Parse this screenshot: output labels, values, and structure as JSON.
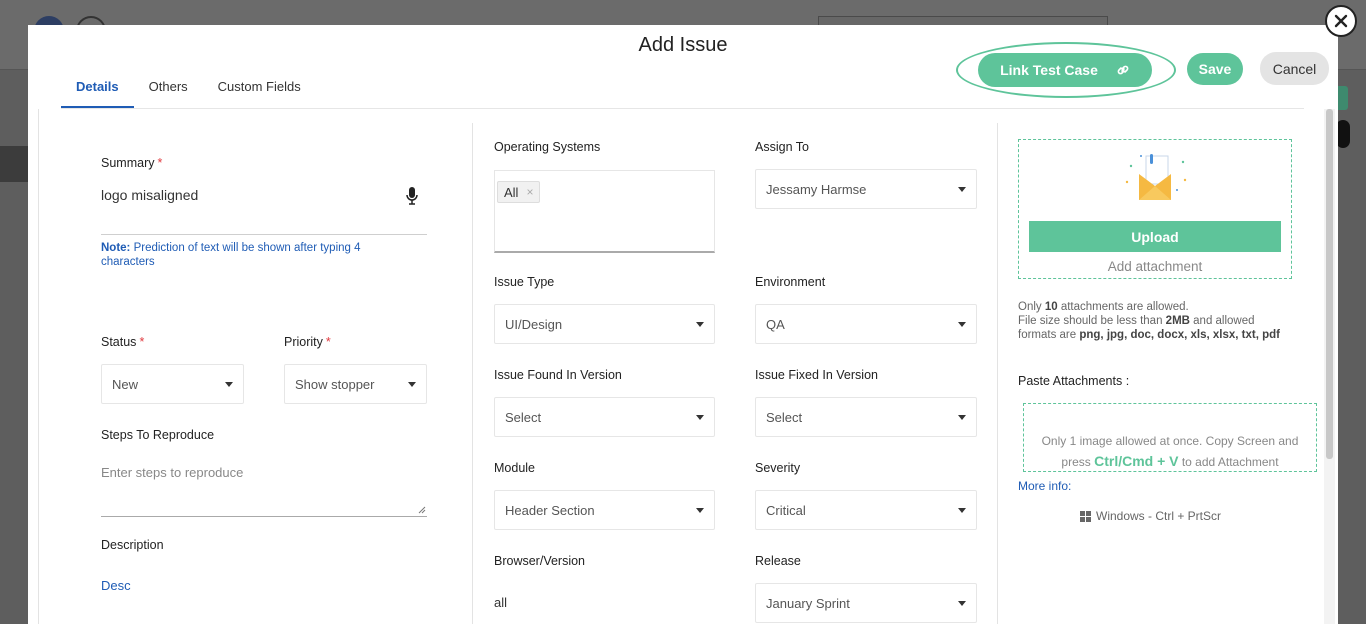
{
  "modal": {
    "title": "Add Issue",
    "tabs": [
      {
        "label": "Details",
        "active": true
      },
      {
        "label": "Others",
        "active": false
      },
      {
        "label": "Custom Fields",
        "active": false
      }
    ],
    "link_test_case_label": "Link Test Case",
    "save_label": "Save",
    "cancel_label": "Cancel"
  },
  "left": {
    "summary_label": "Summary",
    "summary_value": "logo misaligned",
    "note_bold": "Note:",
    "note_text": " Prediction of text will be shown after typing 4 characters",
    "status_label": "Status",
    "status_value": "New",
    "priority_label": "Priority",
    "priority_value": "Show stopper",
    "steps_label": "Steps To Reproduce",
    "steps_placeholder": "Enter steps to reproduce",
    "description_label": "Description",
    "description_value": "Desc",
    "required_mark": "*"
  },
  "middle": {
    "os_label": "Operating Systems",
    "os_chip": "All",
    "chip_remove": "×",
    "issue_type_label": "Issue Type",
    "issue_type_value": "UI/Design",
    "found_version_label": "Issue Found In Version",
    "found_version_value": "Select",
    "module_label": "Module",
    "module_value": "Header Section",
    "browser_label": "Browser/Version",
    "browser_value": "all",
    "assign_label": "Assign To",
    "assign_value": "Jessamy Harmse",
    "environment_label": "Environment",
    "environment_value": "QA",
    "fixed_version_label": "Issue Fixed In Version",
    "fixed_version_value": "Select",
    "severity_label": "Severity",
    "severity_value": "Critical",
    "release_label": "Release",
    "release_value": "January Sprint"
  },
  "right": {
    "upload_label": "Upload",
    "add_attachment_label": "Add attachment",
    "info_1a": "Only ",
    "info_1b": "10",
    "info_1c": " attachments are allowed.",
    "info_2a": "File size should be less than ",
    "info_2b": "2MB",
    "info_2c": " and allowed",
    "info_3a": "formats are ",
    "info_3b": "png, jpg, doc, docx, xls, xlsx, txt, pdf",
    "paste_label": "Paste Attachments :",
    "paste_text_1": "Only 1 image allowed at once. Copy Screen and",
    "paste_text_2a": "press ",
    "paste_key": "Ctrl/Cmd + V",
    "paste_text_2b": " to add Attachment",
    "more_info": "More info:",
    "windows_shortcut": "Windows - Ctrl + PrtScr"
  },
  "colors": {
    "accent_green": "#5ec49a",
    "link_blue": "#1f5cb5",
    "required_red": "#e0393e"
  }
}
